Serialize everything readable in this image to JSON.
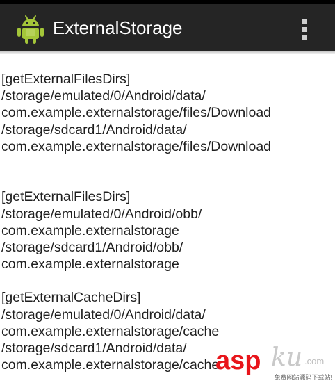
{
  "action_bar": {
    "title": "ExternalStorage",
    "app_icon": "android-robot-icon",
    "overflow_icon": "overflow-menu-icon",
    "background": "#252525"
  },
  "content": {
    "lines": [
      "[getExternalFilesDirs]",
      "/storage/emulated/0/Android/data/",
      "com.example.externalstorage/files/Download",
      "/storage/sdcard1/Android/data/",
      "com.example.externalstorage/files/Download",
      "",
      "",
      "[getExternalFilesDirs]",
      "/storage/emulated/0/Android/obb/",
      "com.example.externalstorage",
      "/storage/sdcard1/Android/obb/",
      "com.example.externalstorage",
      "",
      "[getExternalCacheDirs]",
      "/storage/emulated/0/Android/data/",
      "com.example.externalstorage/cache",
      "/storage/sdcard1/Android/data/",
      "com.example.externalstorage/cache"
    ]
  },
  "watermark": {
    "brand_red": "asp",
    "brand_gray": "ku",
    "suffix": ".com",
    "tagline": "免费网站源码下载站!",
    "brand_color": "#e8151b"
  }
}
